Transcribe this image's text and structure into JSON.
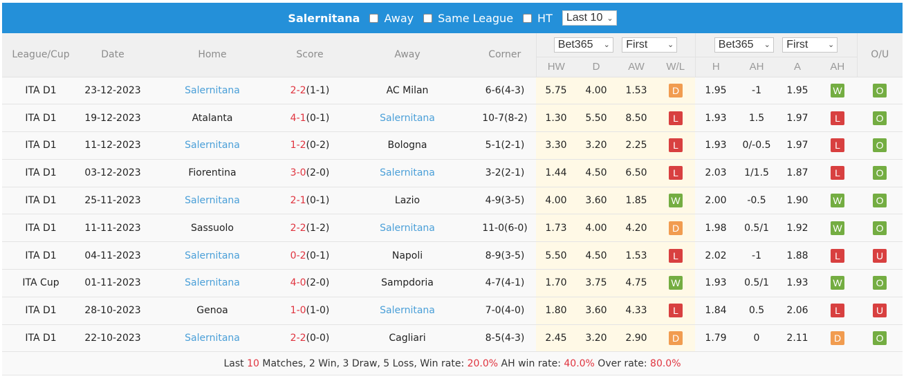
{
  "topbar": {
    "team": "Salernitana",
    "filters": [
      {
        "label": "Away",
        "checked": false
      },
      {
        "label": "Same League",
        "checked": false
      },
      {
        "label": "HT",
        "checked": false
      }
    ],
    "range_select": "Last 10"
  },
  "headers": {
    "league": "League/Cup",
    "date": "Date",
    "home": "Home",
    "score": "Score",
    "away": "Away",
    "corner": "Corner",
    "odds_company": "Bet365",
    "odds_type": "First",
    "ah_company": "Bet365",
    "ah_type": "First",
    "ou": "O/U",
    "hw": "HW",
    "d": "D",
    "aw": "AW",
    "wl": "W/L",
    "h": "H",
    "ah": "AH",
    "a": "A",
    "ah_result": "AH"
  },
  "matches": [
    {
      "league": "ITA D1",
      "date": "23-12-2023",
      "home": "Salernitana",
      "home_is_team": true,
      "score_ft": "2-2",
      "score_ht": "(1-1)",
      "away": "AC Milan",
      "away_is_team": false,
      "corner": "6-6(4-3)",
      "hw": "5.75",
      "d": "4.00",
      "aw": "1.53",
      "wl": "D",
      "h": "1.95",
      "ah": "-1",
      "a": "1.95",
      "ah_res": "W",
      "ou": "O"
    },
    {
      "league": "ITA D1",
      "date": "19-12-2023",
      "home": "Atalanta",
      "home_is_team": false,
      "score_ft": "4-1",
      "score_ht": "(0-1)",
      "away": "Salernitana",
      "away_is_team": true,
      "corner": "10-7(8-2)",
      "hw": "1.30",
      "d": "5.50",
      "aw": "8.50",
      "wl": "L",
      "h": "1.93",
      "ah": "1.5",
      "a": "1.97",
      "ah_res": "L",
      "ou": "O"
    },
    {
      "league": "ITA D1",
      "date": "11-12-2023",
      "home": "Salernitana",
      "home_is_team": true,
      "score_ft": "1-2",
      "score_ht": "(0-2)",
      "away": "Bologna",
      "away_is_team": false,
      "corner": "5-1(2-1)",
      "hw": "3.30",
      "d": "3.20",
      "aw": "2.25",
      "wl": "L",
      "h": "1.93",
      "ah": "0/-0.5",
      "a": "1.97",
      "ah_res": "L",
      "ou": "O"
    },
    {
      "league": "ITA D1",
      "date": "03-12-2023",
      "home": "Fiorentina",
      "home_is_team": false,
      "score_ft": "3-0",
      "score_ht": "(2-0)",
      "away": "Salernitana",
      "away_is_team": true,
      "corner": "3-2(2-1)",
      "hw": "1.44",
      "d": "4.50",
      "aw": "6.50",
      "wl": "L",
      "h": "2.03",
      "ah": "1/1.5",
      "a": "1.87",
      "ah_res": "L",
      "ou": "O"
    },
    {
      "league": "ITA D1",
      "date": "25-11-2023",
      "home": "Salernitana",
      "home_is_team": true,
      "score_ft": "2-1",
      "score_ht": "(0-1)",
      "away": "Lazio",
      "away_is_team": false,
      "corner": "4-9(3-5)",
      "hw": "4.00",
      "d": "3.60",
      "aw": "1.85",
      "wl": "W",
      "h": "2.00",
      "ah": "-0.5",
      "a": "1.90",
      "ah_res": "W",
      "ou": "O"
    },
    {
      "league": "ITA D1",
      "date": "11-11-2023",
      "home": "Sassuolo",
      "home_is_team": false,
      "score_ft": "2-2",
      "score_ht": "(1-2)",
      "away": "Salernitana",
      "away_is_team": true,
      "corner": "11-0(6-0)",
      "hw": "1.73",
      "d": "4.00",
      "aw": "4.20",
      "wl": "D",
      "h": "1.98",
      "ah": "0.5/1",
      "a": "1.92",
      "ah_res": "W",
      "ou": "O"
    },
    {
      "league": "ITA D1",
      "date": "04-11-2023",
      "home": "Salernitana",
      "home_is_team": true,
      "score_ft": "0-2",
      "score_ht": "(0-1)",
      "away": "Napoli",
      "away_is_team": false,
      "corner": "8-9(3-5)",
      "hw": "5.50",
      "d": "4.50",
      "aw": "1.53",
      "wl": "L",
      "h": "2.02",
      "ah": "-1",
      "a": "1.88",
      "ah_res": "L",
      "ou": "U"
    },
    {
      "league": "ITA Cup",
      "date": "01-11-2023",
      "home": "Salernitana",
      "home_is_team": true,
      "score_ft": "4-0",
      "score_ht": "(2-0)",
      "away": "Sampdoria",
      "away_is_team": false,
      "corner": "4-7(4-1)",
      "hw": "1.70",
      "d": "3.75",
      "aw": "4.75",
      "wl": "W",
      "h": "1.93",
      "ah": "0.5/1",
      "a": "1.93",
      "ah_res": "W",
      "ou": "O"
    },
    {
      "league": "ITA D1",
      "date": "28-10-2023",
      "home": "Genoa",
      "home_is_team": false,
      "score_ft": "1-0",
      "score_ht": "(1-0)",
      "away": "Salernitana",
      "away_is_team": true,
      "corner": "7-0(4-0)",
      "hw": "1.80",
      "d": "3.60",
      "aw": "4.33",
      "wl": "L",
      "h": "1.84",
      "ah": "0.5",
      "a": "2.06",
      "ah_res": "L",
      "ou": "U"
    },
    {
      "league": "ITA D1",
      "date": "22-10-2023",
      "home": "Salernitana",
      "home_is_team": true,
      "score_ft": "2-2",
      "score_ht": "(0-0)",
      "away": "Cagliari",
      "away_is_team": false,
      "corner": "8-5(4-3)",
      "hw": "2.45",
      "d": "3.20",
      "aw": "2.90",
      "wl": "D",
      "h": "1.79",
      "ah": "0",
      "a": "2.11",
      "ah_res": "D",
      "ou": "O"
    }
  ],
  "summary": {
    "prefix": "Last ",
    "count": "10",
    "mid": " Matches, 2 Win, 3 Draw, 5 Loss, Win rate: ",
    "win_rate": "20.0%",
    "ah_label": " AH win rate: ",
    "ah_rate": "40.0%",
    "over_label": " Over rate: ",
    "over_rate": "80.0%"
  }
}
